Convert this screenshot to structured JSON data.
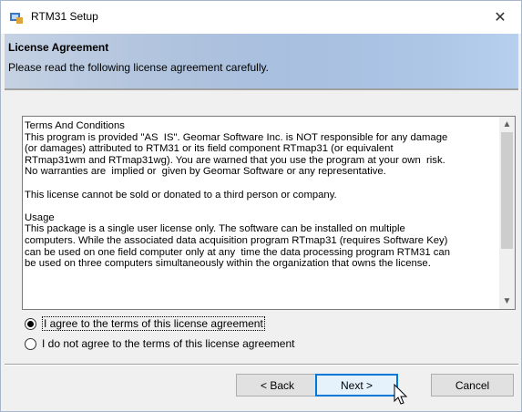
{
  "window": {
    "title": "RTM31 Setup",
    "close_glyph": "✕"
  },
  "header": {
    "title": "License Agreement",
    "subtitle": "Please read the following license agreement carefully."
  },
  "license": {
    "text": "Terms And Conditions\nThis program is provided \"AS  IS\". Geomar Software Inc. is NOT responsible for any damage\n(or damages) attributed to RTM31 or its field component RTmap31 (or equivalent\nRTmap31wm and RTmap31wg). You are warned that you use the program at your own  risk.\nNo warranties are  implied or  given by Geomar Software or any representative.\n\nThis license cannot be sold or donated to a third person or company.\n\nUsage\nThis package is a single user license only. The software can be installed on multiple\ncomputers. While the associated data acquisition program RTmap31 (requires Software Key)\ncan be used on one field computer only at any  time the data processing program RTM31 can\nbe used on three computers simultaneously within the organization that owns the license."
  },
  "options": {
    "agree": "I agree to the terms of this license agreement",
    "disagree": "I do not agree to the terms of this license agreement",
    "selected": "agree"
  },
  "buttons": {
    "back": "< Back",
    "next": "Next >",
    "cancel": "Cancel"
  },
  "icons": {
    "app": "setup-icon",
    "scroll_up": "▲",
    "scroll_down": "▼"
  }
}
